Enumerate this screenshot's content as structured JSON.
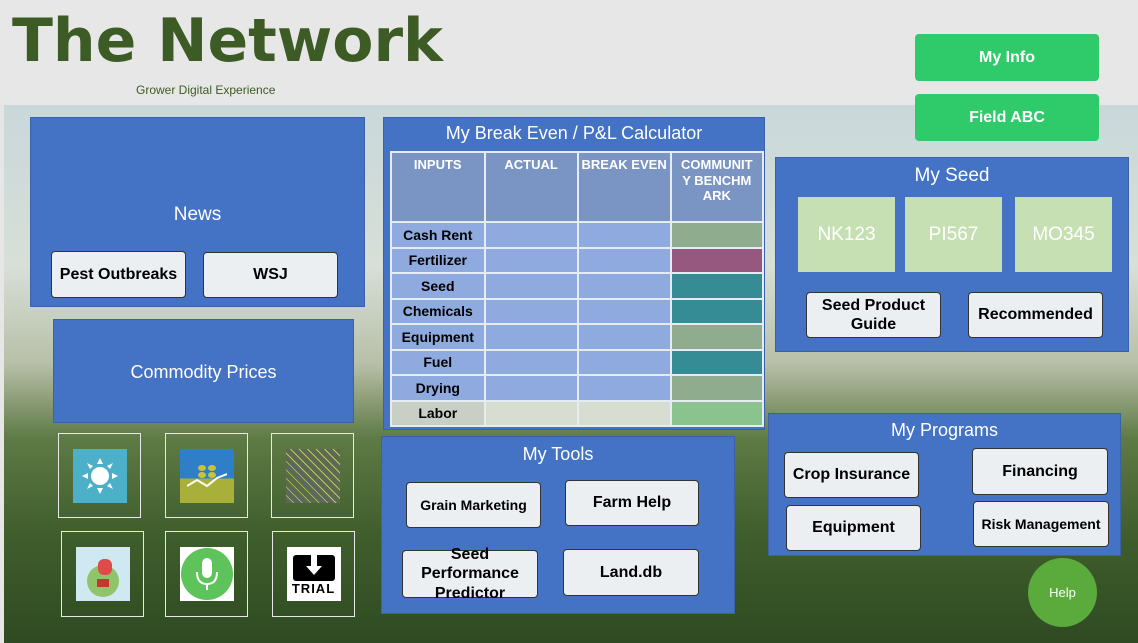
{
  "header": {
    "title": "The Network",
    "subtitle": "Grower Digital Experience"
  },
  "top_buttons": {
    "my_info": "My Info",
    "field": "Field ABC"
  },
  "news": {
    "title": "News",
    "buttons": [
      "Pest Outbreaks",
      "WSJ"
    ]
  },
  "commodity": {
    "title": "Commodity Prices"
  },
  "app_icons": [
    "weather-icon",
    "grain-market-icon",
    "field-map-icon",
    "farm-for-sale-icon",
    "microphone-icon",
    "trial-download-icon"
  ],
  "trial_label": "TRIAL",
  "calculator": {
    "title": "My Break Even / P&L Calculator",
    "columns": [
      "INPUTS",
      "ACTUAL",
      "BREAK EVEN",
      "COMMUNITY BENCHMARK"
    ],
    "rows": [
      "Cash Rent",
      "Fertilizer",
      "Seed",
      "Chemicals",
      "Equipment",
      "Fuel",
      "Drying",
      "Labor"
    ],
    "benchmark_colors": [
      "#8fac8e",
      "#97587f",
      "#368c94",
      "#368c94",
      "#8fac8e",
      "#368c94",
      "#8fac8e",
      "#8bc38f"
    ]
  },
  "seed": {
    "title": "My Seed",
    "products": [
      "NK123",
      "PI567",
      "MO345"
    ],
    "buttons": [
      "Seed Product Guide",
      "Recommended"
    ]
  },
  "tools": {
    "title": "My Tools",
    "buttons": [
      "Grain Marketing",
      "Farm Help",
      "Seed Performance Predictor",
      "Land.db"
    ]
  },
  "programs": {
    "title": "My Programs",
    "buttons": [
      "Crop Insurance",
      "Financing",
      "Equipment",
      "Risk Management"
    ]
  },
  "help": "Help",
  "colors": {
    "panel": "#4472c4",
    "brand_green": "#3d5b24",
    "button_green": "#2fcb6b",
    "help_green": "#5aaa3c"
  }
}
